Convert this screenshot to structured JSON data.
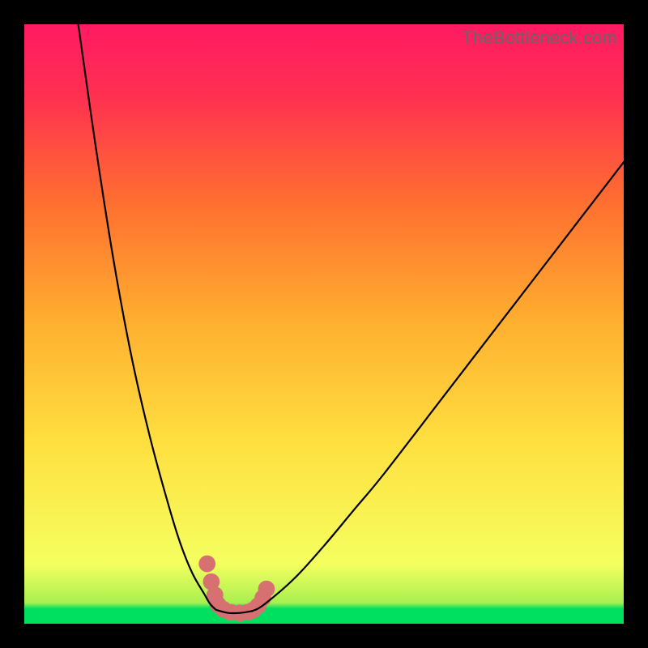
{
  "watermark": "TheBottleneck.com",
  "colors": {
    "frame": "#000000",
    "gradient_stops": [
      "#00e060",
      "#a8f050",
      "#f5ff60",
      "#ffe040",
      "#ffb030",
      "#ff7030",
      "#ff3050",
      "#ff1a63"
    ],
    "curve": "#000000",
    "marker": "#d77070"
  },
  "chart_data": {
    "type": "line",
    "title": "",
    "xlabel": "",
    "ylabel": "",
    "description": "Bottleneck-style V curve. X axis is an unlabeled continuous parameter (0–100% of plot width). Y axis is an unlabeled continuous value (0 at bottom, 100 at top). Color background encodes severity from green (low) through yellow/orange to red/magenta (high). Two black curves meet near x≈35 at the bottom; the left branch rises steeply to the top-left, the right branch rises more gently toward the upper-right. Salmon markers highlight the valley region.",
    "xlim": [
      0,
      100
    ],
    "ylim": [
      0,
      100
    ],
    "series": [
      {
        "name": "left-branch",
        "x": [
          9,
          12,
          15,
          18,
          21,
          24,
          26,
          28,
          30,
          31,
          32
        ],
        "y": [
          100,
          79,
          60,
          44,
          31,
          20,
          13.5,
          8.5,
          5,
          3.3,
          2.3
        ]
      },
      {
        "name": "valley-floor",
        "x": [
          32,
          34,
          36,
          38
        ],
        "y": [
          2.3,
          1.8,
          1.8,
          2.1
        ]
      },
      {
        "name": "right-branch",
        "x": [
          38,
          40,
          45,
          50,
          55,
          60,
          70,
          80,
          90,
          100
        ],
        "y": [
          2.1,
          3.2,
          7.5,
          13,
          19,
          25,
          38,
          51,
          64,
          77
        ]
      }
    ],
    "markers": {
      "name": "highlighted-valley",
      "points": [
        {
          "x": 30.5,
          "y": 10
        },
        {
          "x": 31.2,
          "y": 7
        },
        {
          "x": 31.8,
          "y": 4.8
        },
        {
          "x": 32.3,
          "y": 3.2
        },
        {
          "x": 33.2,
          "y": 2.4
        },
        {
          "x": 34.5,
          "y": 1.9
        },
        {
          "x": 36.0,
          "y": 1.8
        },
        {
          "x": 37.2,
          "y": 1.9
        },
        {
          "x": 38.2,
          "y": 2.3
        },
        {
          "x": 39.0,
          "y": 3.0
        },
        {
          "x": 39.8,
          "y": 4.3
        },
        {
          "x": 40.4,
          "y": 5.8
        }
      ],
      "radius_pct": 1.4
    }
  }
}
